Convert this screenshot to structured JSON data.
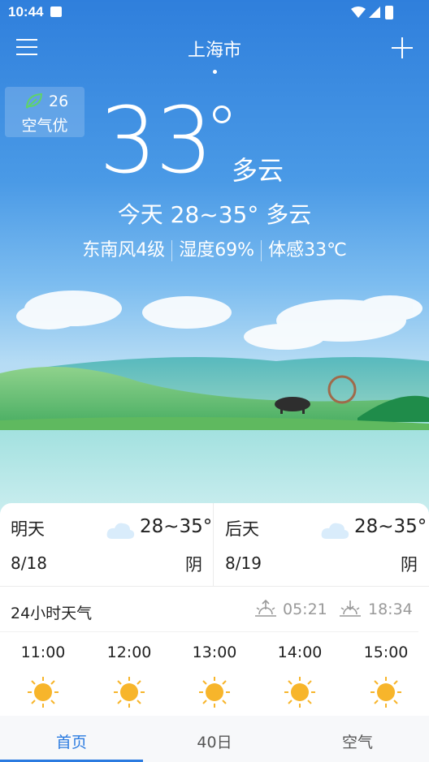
{
  "status_bar": {
    "time": "10:44"
  },
  "header": {
    "city": "上海市"
  },
  "air_quality": {
    "value": "26",
    "label": "空气优"
  },
  "current": {
    "temperature": "33",
    "condition": "多云",
    "today_summary": "今天 28~35° 多云",
    "wind": "东南风4级",
    "humidity": "湿度69%",
    "feels_like": "体感33℃"
  },
  "forecast": [
    {
      "day": "明天",
      "range": "28~35°",
      "date": "8/18",
      "condition": "阴",
      "icon": "cloud-icon"
    },
    {
      "day": "后天",
      "range": "28~35°",
      "date": "8/19",
      "condition": "阴",
      "icon": "cloud-icon"
    }
  ],
  "hourly": {
    "title": "24小时天气",
    "sunrise": "05:21",
    "sunset": "18:34",
    "hours": [
      {
        "time": "11:00",
        "icon": "sun-icon"
      },
      {
        "time": "12:00",
        "icon": "sun-icon"
      },
      {
        "time": "13:00",
        "icon": "sun-icon"
      },
      {
        "time": "14:00",
        "icon": "sun-icon"
      },
      {
        "time": "15:00",
        "icon": "sun-icon"
      }
    ]
  },
  "tabs": [
    "首页",
    "40日",
    "空气"
  ],
  "colors": {
    "accent": "#2b7be0",
    "sky_top": "#2f7fdc",
    "sun": "#f7b52b"
  }
}
